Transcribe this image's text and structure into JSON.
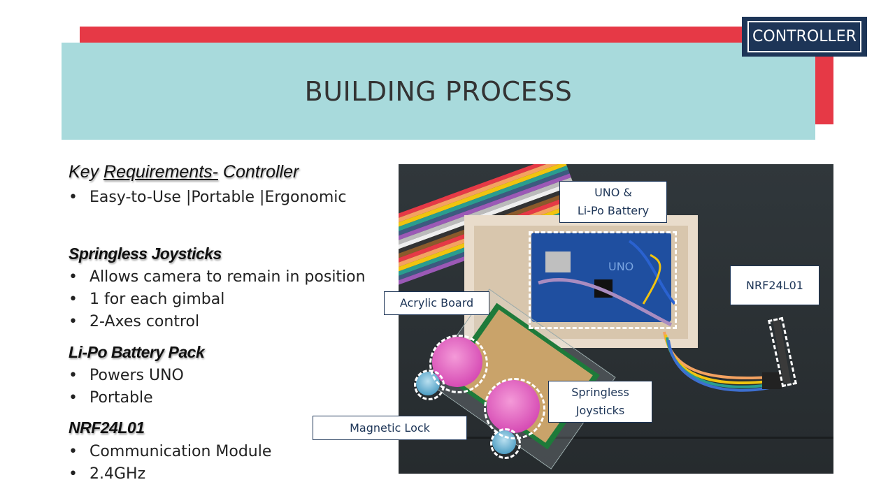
{
  "slide": {
    "title": "BUILDING PROCESS",
    "section_tag": "CONTROLLER",
    "colors": {
      "accent_red": "#e63946",
      "teal": "#a8dadc",
      "navy": "#1d3557",
      "text": "#222222"
    }
  },
  "content": {
    "key_requirements": {
      "prefix": "Key ",
      "underlined": "Requirements-",
      "suffix": " Controller",
      "bullets": [
        "Easy-to-Use |Portable |Ergonomic"
      ]
    },
    "sections": [
      {
        "heading": "Springless Joysticks",
        "bullets": [
          "Allows camera to remain in position",
          "1 for each gimbal",
          "2-Axes control"
        ]
      },
      {
        "heading": "Li-Po Battery Pack",
        "bullets": [
          "Powers UNO",
          "Portable"
        ]
      },
      {
        "heading": "NRF24L01",
        "bullets": [
          "Communication Module",
          "2.4GHz"
        ]
      }
    ],
    "bullet_glyph": "•"
  },
  "photo": {
    "description": "Top-down photo of controller build: wooden box containing Arduino UNO, protoboard with two pink joysticks, rainbow ribbon cable, NRF24L01 module",
    "callouts": {
      "uno_battery": [
        "UNO &",
        "Li-Po Battery"
      ],
      "nrf": "NRF24L01",
      "acrylic": "Acrylic Board",
      "joysticks": [
        "Springless",
        "Joysticks"
      ],
      "magnetic_lock": "Magnetic Lock"
    }
  }
}
